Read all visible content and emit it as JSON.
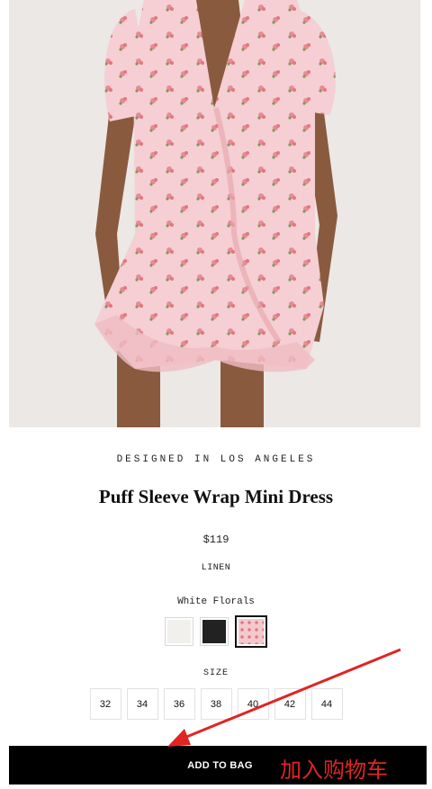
{
  "product": {
    "tagline": "DESIGNED IN LOS ANGELES",
    "title": "Puff Sleeve Wrap Mini Dress",
    "price": "$119",
    "material": "LINEN",
    "color_label": "White Florals",
    "swatches": [
      {
        "name": "White",
        "color": "#f2f0ec",
        "selected": false
      },
      {
        "name": "Black",
        "color": "#222222",
        "selected": false
      },
      {
        "name": "Pink Florals",
        "color": "#f4c9cd",
        "selected": true
      }
    ],
    "size_label": "SIZE",
    "sizes": [
      "32",
      "34",
      "36",
      "38",
      "40",
      "42",
      "44"
    ]
  },
  "cta": {
    "label": "ADD TO BAG"
  },
  "annotation": {
    "text": "加入购物车",
    "color": "#e02424"
  },
  "photo": {
    "subject": "model wearing pink floral wrap mini dress"
  }
}
